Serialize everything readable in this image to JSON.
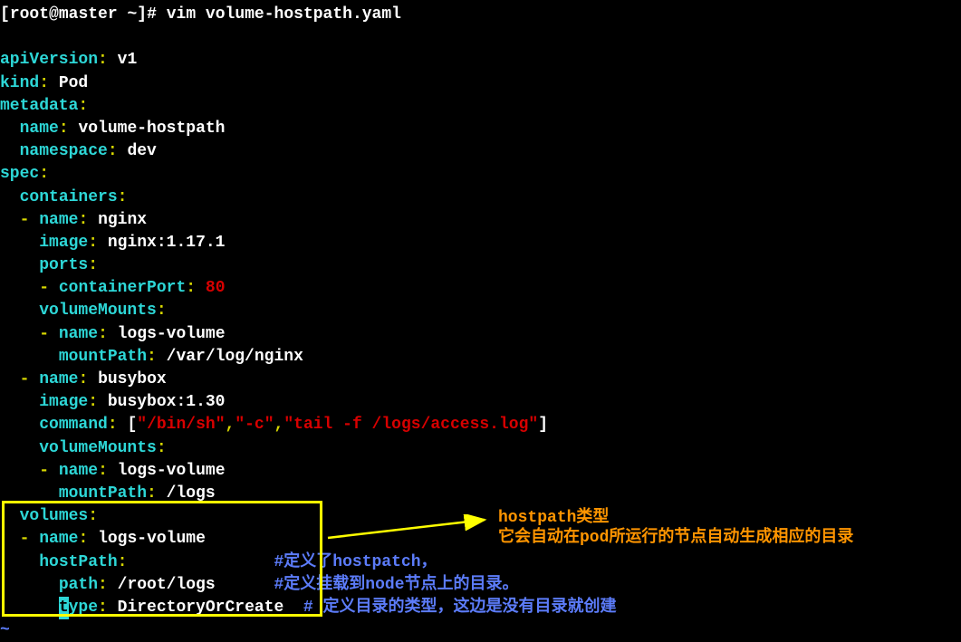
{
  "prompt": {
    "user": "root",
    "host": "master",
    "path": "~",
    "symbol": "#",
    "command": "vim volume-hostpath.yaml"
  },
  "yaml": {
    "apiVersion_key": "apiVersion",
    "apiVersion_val": " v1",
    "kind_key": "kind",
    "kind_val": " Pod",
    "metadata_key": "metadata",
    "name_key": "name",
    "name_val": " volume-hostpath",
    "namespace_key": "namespace",
    "namespace_val": " dev",
    "spec_key": "spec",
    "containers_key": "containers",
    "c1_name_key": "name",
    "c1_name_val": " nginx",
    "c1_image_key": "image",
    "c1_image_val": " nginx:1.17.1",
    "c1_ports_key": "ports",
    "c1_cport_key": "containerPort",
    "c1_cport_val": " 80",
    "c1_vm_key": "volumeMounts",
    "c1_vm_name_key": "name",
    "c1_vm_name_val": " logs-volume",
    "c1_vm_mp_key": "mountPath",
    "c1_vm_mp_val": " /var/log/nginx",
    "c2_name_key": "name",
    "c2_name_val": " busybox",
    "c2_image_key": "image",
    "c2_image_val": " busybox:1.30",
    "c2_cmd_key": "command",
    "c2_cmd_b1": "[",
    "c2_cmd_v1": "\"/bin/sh\"",
    "c2_cmd_c1": ",",
    "c2_cmd_v2": "\"-c\"",
    "c2_cmd_c2": ",",
    "c2_cmd_v3": "\"tail -f /logs/access.log\"",
    "c2_cmd_b2": "]",
    "c2_vm_key": "volumeMounts",
    "c2_vm_name_key": "name",
    "c2_vm_name_val": " logs-volume",
    "c2_vm_mp_key": "mountPath",
    "c2_vm_mp_val": " /logs",
    "volumes_key": "volumes",
    "v_name_key": "name",
    "v_name_val": " logs-volume",
    "v_hp_key": "hostPath",
    "v_path_key": "path",
    "v_path_val": " /root/logs",
    "v_type_key_t": "t",
    "v_type_key_ype": "ype",
    "v_type_val": " DirectoryOrCreate"
  },
  "comments": {
    "c1": "#定义了hostpatch，",
    "c2": "#定义挂载到node节点上的目录。",
    "c3": "# 定义目录的类型，这边是没有目录就创建"
  },
  "annotations": {
    "title": "hostpath类型",
    "desc": "它会自动在pod所运行的节点自动生成相应的目录"
  },
  "chars": {
    "colon": ":",
    "dash": "-",
    "space1": " ",
    "space2": "  ",
    "space3": "    ",
    "space6": "      ",
    "lbracket": "[",
    "rbracket": "]",
    "at": "@",
    "tilde": "~"
  }
}
